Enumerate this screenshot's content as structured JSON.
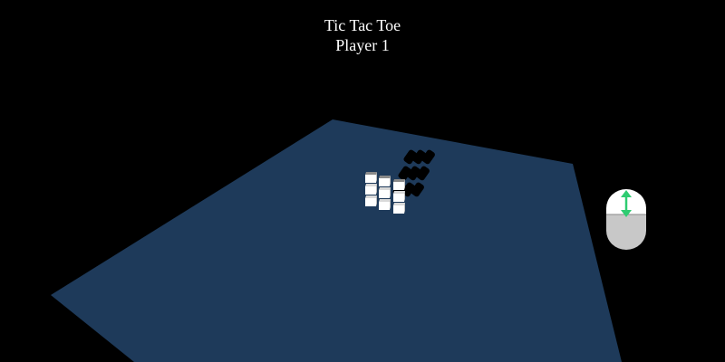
{
  "game": {
    "title": "Tic Tac Toe",
    "status": "Player 1"
  },
  "board": {
    "size": 3,
    "layers": 3,
    "cell_color": "#ffffff",
    "top_cell_color": "#8a8a8a",
    "shadow_color": "#000000"
  },
  "colors": {
    "background": "#000000",
    "ground": "#1e3a5a",
    "text": "#ffffff",
    "mouse_body": "#c8c8c8",
    "mouse_top": "#ffffff",
    "mouse_arrow": "#2ecc71"
  },
  "hint": {
    "icon": "mouse-scroll-icon"
  }
}
